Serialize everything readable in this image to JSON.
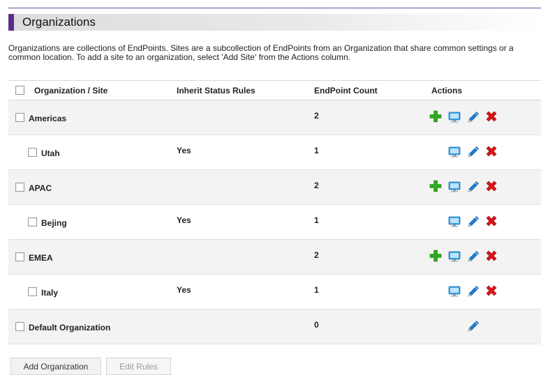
{
  "header": {
    "title": "Organizations"
  },
  "intro": {
    "text": "Organizations are collections of EndPoints. Sites are a subcollection of EndPoints from an Organization that share common settings or a common location. To add a site to an organization, select 'Add Site' from the Actions column."
  },
  "table": {
    "columns": {
      "org_site": "Organization / Site",
      "inherit": "Inherit Status Rules",
      "count": "EndPoint Count",
      "actions": "Actions"
    },
    "rows": [
      {
        "kind": "org",
        "name": "Americas",
        "inherit": "",
        "count": "2",
        "actions": [
          "plus-icon",
          "monitor-icon",
          "pencil-icon",
          "delete-icon"
        ]
      },
      {
        "kind": "site",
        "name": "Utah",
        "inherit": "Yes",
        "count": "1",
        "actions": [
          "monitor-icon",
          "pencil-icon",
          "delete-icon"
        ]
      },
      {
        "kind": "org",
        "name": "APAC",
        "inherit": "",
        "count": "2",
        "actions": [
          "plus-icon",
          "monitor-icon",
          "pencil-icon",
          "delete-icon"
        ]
      },
      {
        "kind": "site",
        "name": "Bejing",
        "inherit": "Yes",
        "count": "1",
        "actions": [
          "monitor-icon",
          "pencil-icon",
          "delete-icon"
        ]
      },
      {
        "kind": "org",
        "name": "EMEA",
        "inherit": "",
        "count": "2",
        "actions": [
          "plus-icon",
          "monitor-icon",
          "pencil-icon",
          "delete-icon"
        ]
      },
      {
        "kind": "site",
        "name": "Italy",
        "inherit": "Yes",
        "count": "1",
        "actions": [
          "monitor-icon",
          "pencil-icon",
          "delete-icon"
        ]
      },
      {
        "kind": "org",
        "name": "Default Organization",
        "inherit": "",
        "count": "0",
        "actions": [
          "pencil-icon"
        ]
      }
    ]
  },
  "buttons": {
    "add_organization": "Add Organization",
    "edit_rules": "Edit Rules"
  },
  "colors": {
    "accent": "#5b2d8a",
    "add": "#2eaa1e",
    "delete": "#d8151a",
    "edit": "#1e7fd6",
    "monitor": "#3fa2e3"
  }
}
